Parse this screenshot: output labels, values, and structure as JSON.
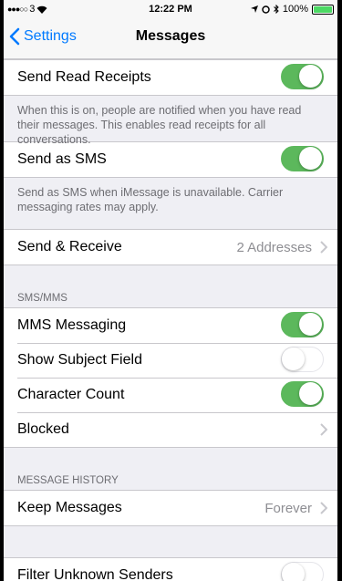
{
  "status": {
    "carrier": "3",
    "time": "12:22 PM",
    "battery": "100%",
    "battery_level": 1.0
  },
  "nav": {
    "back_label": "Settings",
    "title": "Messages"
  },
  "read_receipts": {
    "label": "Send Read Receipts",
    "on": true,
    "footer": "When this is on, people are notified when you have read their messages. This enables read receipts for all conversations."
  },
  "send_sms": {
    "label": "Send as SMS",
    "on": true,
    "footer": "Send as SMS when iMessage is unavailable. Carrier messaging rates may apply."
  },
  "send_receive": {
    "label": "Send & Receive",
    "value": "2 Addresses"
  },
  "sms_mms": {
    "header": "SMS/MMS",
    "mms": {
      "label": "MMS Messaging",
      "on": true
    },
    "subject": {
      "label": "Show Subject Field",
      "on": false
    },
    "charcount": {
      "label": "Character Count",
      "on": true
    },
    "blocked": {
      "label": "Blocked"
    }
  },
  "history": {
    "header": "MESSAGE HISTORY",
    "keep": {
      "label": "Keep Messages",
      "value": "Forever"
    }
  },
  "filter": {
    "label": "Filter Unknown Senders",
    "on": false
  },
  "colors": {
    "accent": "#007aff",
    "toggle_on": "#5cb85c"
  }
}
